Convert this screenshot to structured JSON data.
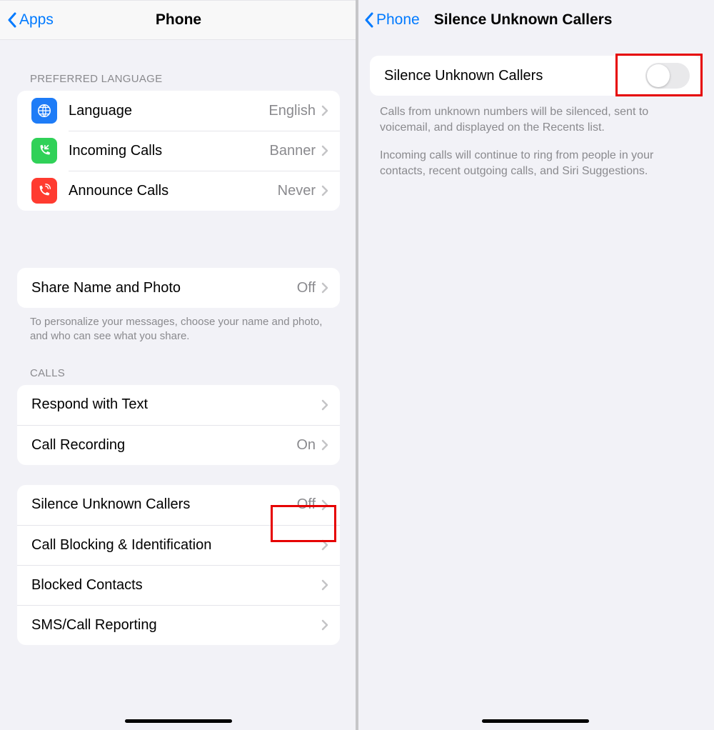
{
  "left": {
    "nav": {
      "back": "Apps",
      "title": "Phone"
    },
    "sections": {
      "pref_header": "PREFERRED LANGUAGE",
      "language": {
        "label": "Language",
        "value": "English"
      },
      "incoming": {
        "label": "Incoming Calls",
        "value": "Banner"
      },
      "announce": {
        "label": "Announce Calls",
        "value": "Never"
      },
      "share": {
        "label": "Share Name and Photo",
        "value": "Off"
      },
      "share_footer": "To personalize your messages, choose your name and photo, and who can see what you share.",
      "calls_header": "CALLS",
      "respond": {
        "label": "Respond with Text"
      },
      "recording": {
        "label": "Call Recording",
        "value": "On"
      },
      "silence": {
        "label": "Silence Unknown Callers",
        "value": "Off"
      },
      "blocking": {
        "label": "Call Blocking & Identification"
      },
      "blocked": {
        "label": "Blocked Contacts"
      },
      "sms": {
        "label": "SMS/Call Reporting"
      }
    }
  },
  "right": {
    "nav": {
      "back": "Phone",
      "title": "Silence Unknown Callers"
    },
    "row": {
      "label": "Silence Unknown Callers",
      "enabled": false
    },
    "footer1": "Calls from unknown numbers will be silenced, sent to voicemail, and displayed on the Recents list.",
    "footer2": "Incoming calls will continue to ring from people in your contacts, recent outgoing calls, and Siri Suggestions."
  }
}
